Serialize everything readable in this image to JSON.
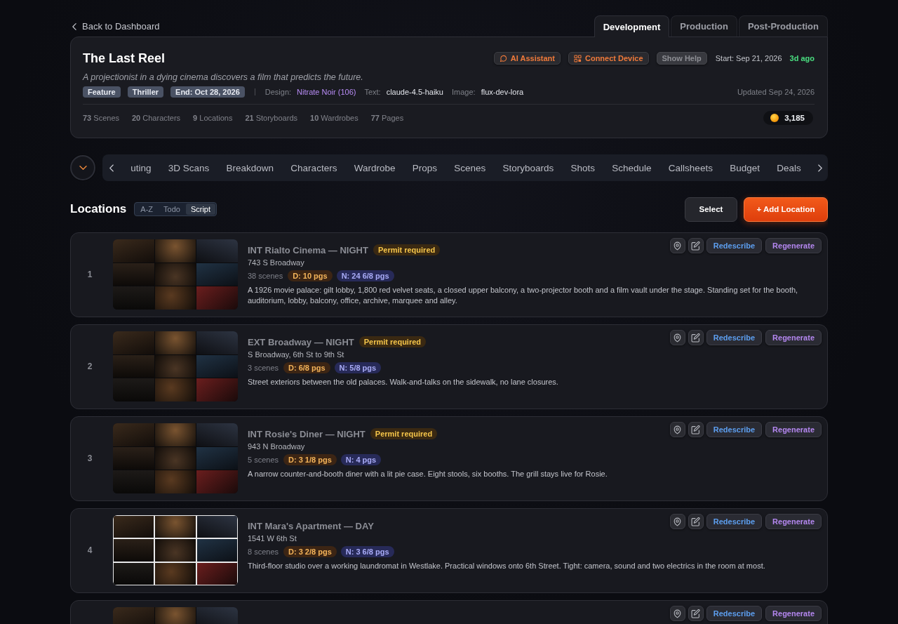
{
  "back_link": {
    "label": "Back to Dashboard"
  },
  "phase_tabs": [
    {
      "label": "Development",
      "selected": true
    },
    {
      "label": "Production",
      "selected": false
    },
    {
      "label": "Post-Production",
      "selected": false
    }
  ],
  "project": {
    "title": "The Last Reel",
    "actions": [
      {
        "label": "AI Assistant",
        "kind": "chat"
      },
      {
        "label": "Connect Device",
        "kind": "device"
      },
      {
        "label": "Show Help",
        "kind": "plain"
      }
    ],
    "start": "Start: Sep 21, 2026",
    "age": "3d ago",
    "logline": "A projectionist in a dying cinema discovers a film that predicts the future.",
    "tags": [
      "Feature",
      "Thriller",
      "End: Oct 28, 2026"
    ],
    "meta": [
      {
        "label": "Design:",
        "value": "Nitrate Noir (106)",
        "kind": "link"
      },
      {
        "label": "Text:",
        "value": "claude-4.5-haiku",
        "kind": "plain"
      },
      {
        "label": "Image:",
        "value": "flux-dev-lora",
        "kind": "plain"
      }
    ],
    "updated": "Updated Sep 24, 2026",
    "stats": [
      "**73** Scenes",
      "**20** Characters",
      "**9** Locations",
      "**21** Storyboards",
      "**10** Wardrobes",
      "**77** Pages"
    ],
    "credits": "3,185"
  },
  "section_nav": {
    "tabs": [
      {
        "label": "uting",
        "selected": false
      },
      {
        "label": "3D Scans",
        "selected": false
      },
      {
        "label": "Breakdown",
        "selected": false
      },
      {
        "label": "Characters",
        "selected": false
      },
      {
        "label": "Wardrobe",
        "selected": false
      },
      {
        "label": "Props",
        "selected": false
      },
      {
        "label": "Scenes",
        "selected": false
      },
      {
        "label": "Storyboards",
        "selected": false
      },
      {
        "label": "Shots",
        "selected": false
      },
      {
        "label": "Schedule",
        "selected": false
      },
      {
        "label": "Callsheets",
        "selected": false
      },
      {
        "label": "Budget",
        "selected": false
      },
      {
        "label": "Deals",
        "selected": false
      }
    ]
  },
  "locations_header": {
    "title": "Locations",
    "sort_options": [
      {
        "label": "A-Z",
        "selected": false
      },
      {
        "label": "Todo",
        "selected": false
      },
      {
        "label": "Script",
        "selected": true
      }
    ],
    "buttons": [
      {
        "label": "Select",
        "kind": "secondary"
      },
      {
        "label": "+ Add Location",
        "kind": "primary"
      }
    ]
  },
  "locations": [
    {
      "number": "1",
      "heading": "INT **Rialto Cinema** — NIGHT",
      "badge": "Permit required",
      "address": "743 S Broadway",
      "scenes": "38 scenes",
      "day_pages": "D: 10 pgs",
      "night_pages": "N: 24 6/8 pgs",
      "description": "A 1926 movie palace: gilt lobby, 1,800 red velvet seats, a closed upper balcony, a two-projector booth and a film vault under the stage. Standing set for the booth, auditorium, lobby, balcony, office, archive, marquee and alley.",
      "thumbnail_framed": false,
      "actions": [
        {
          "label": "Redescribe",
          "kind": "describe"
        },
        {
          "label": "Regenerate",
          "kind": "generate"
        }
      ]
    },
    {
      "number": "2",
      "heading": "EXT **Broadway** — NIGHT",
      "badge": "Permit required",
      "address": "S Broadway, 6th St to 9th St",
      "scenes": "3 scenes",
      "day_pages": "D: 6/8 pgs",
      "night_pages": "N: 5/8 pgs",
      "description": "Street exteriors between the old palaces. Walk-and-talks on the sidewalk, no lane closures.",
      "thumbnail_framed": false,
      "actions": [
        {
          "label": "Redescribe",
          "kind": "describe"
        },
        {
          "label": "Regenerate",
          "kind": "generate"
        }
      ]
    },
    {
      "number": "3",
      "heading": "INT **Rosie's Diner** — NIGHT",
      "badge": "Permit required",
      "address": "943 N Broadway",
      "scenes": "5 scenes",
      "day_pages": "D: 3 1/8 pgs",
      "night_pages": "N: 4 pgs",
      "description": "A narrow counter-and-booth diner with a lit pie case. Eight stools, six booths. The grill stays live for Rosie.",
      "thumbnail_framed": false,
      "actions": [
        {
          "label": "Redescribe",
          "kind": "describe"
        },
        {
          "label": "Regenerate",
          "kind": "generate"
        }
      ]
    },
    {
      "number": "4",
      "heading": "INT **Mara's Apartment** — DAY",
      "address": "1541 W 6th St",
      "scenes": "8 scenes",
      "day_pages": "D: 3 2/8 pgs",
      "night_pages": "N: 3 6/8 pgs",
      "description": "Third-floor studio over a working laundromat in Westlake. Practical windows onto 6th Street. Tight: camera, sound and two electrics in the room at most.",
      "thumbnail_framed": true,
      "actions": [
        {
          "label": "Redescribe",
          "kind": "describe"
        },
        {
          "label": "Regenerate",
          "kind": "generate"
        }
      ]
    },
    {
      "thumbnail_framed": false,
      "actions": [
        {
          "label": "Redescribe",
          "kind": "describe"
        },
        {
          "label": "Regenerate",
          "kind": "generate"
        }
      ]
    }
  ]
}
